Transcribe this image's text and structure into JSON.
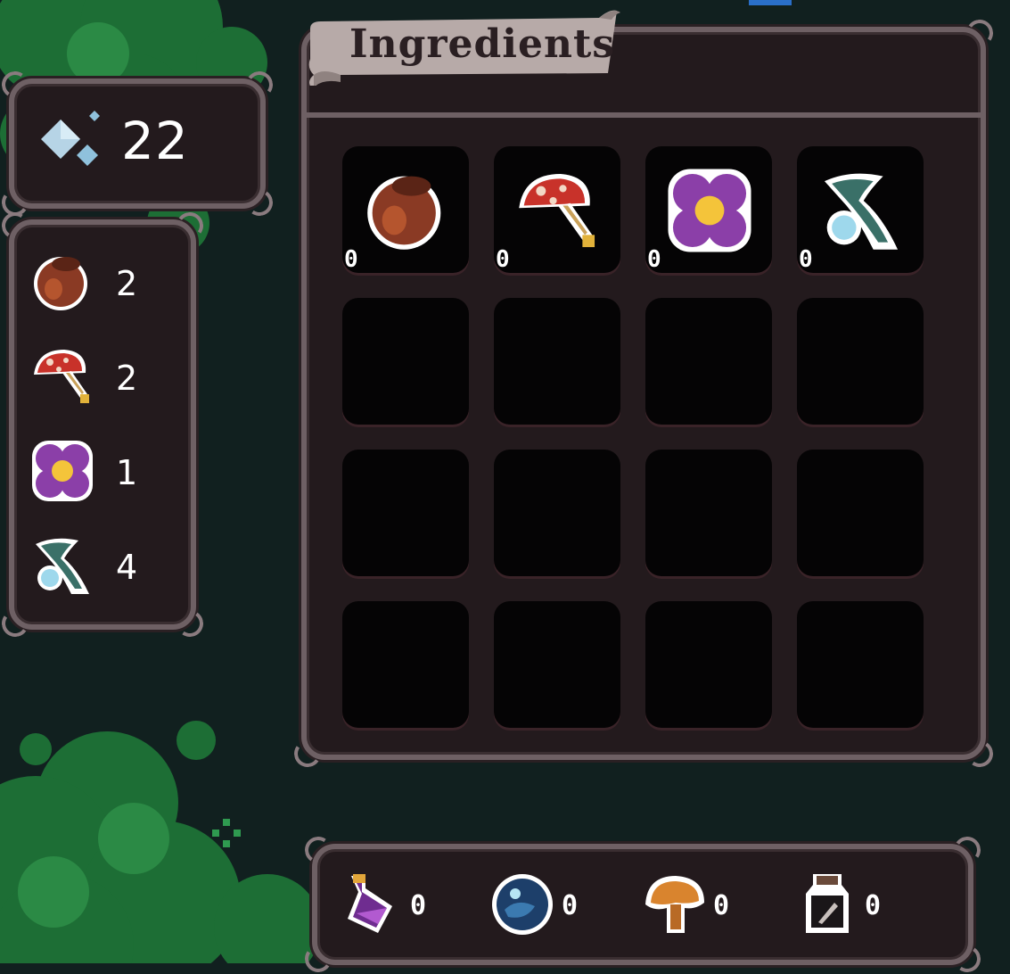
{
  "currency": {
    "value": "22",
    "icon": "crystal-gem-icon"
  },
  "inventory": {
    "items": [
      {
        "icon": "clay-pot-icon",
        "count": "2"
      },
      {
        "icon": "red-mushroom-icon",
        "count": "2"
      },
      {
        "icon": "purple-flower-icon",
        "count": "1"
      },
      {
        "icon": "dewdrop-herb-icon",
        "count": "4"
      }
    ]
  },
  "ingredients": {
    "title": "Ingredients",
    "slots": [
      {
        "icon": "clay-pot-icon",
        "qty": "0"
      },
      {
        "icon": "red-mushroom-icon",
        "qty": "0"
      },
      {
        "icon": "purple-flower-icon",
        "qty": "0"
      },
      {
        "icon": "dewdrop-herb-icon",
        "qty": "0"
      }
    ]
  },
  "potions": [
    {
      "icon": "purple-potion-icon",
      "qty": "0"
    },
    {
      "icon": "blue-orb-icon",
      "qty": "0"
    },
    {
      "icon": "orange-mushroom-icon",
      "qty": "0"
    },
    {
      "icon": "dark-jar-icon",
      "qty": "0"
    }
  ],
  "colors": {
    "background": "#11201f",
    "foliage": "#1f7a3a",
    "panel": "#231a1d",
    "frame": "#6e6064",
    "slot": "#050405",
    "ribbon": "#b7aaa8"
  }
}
